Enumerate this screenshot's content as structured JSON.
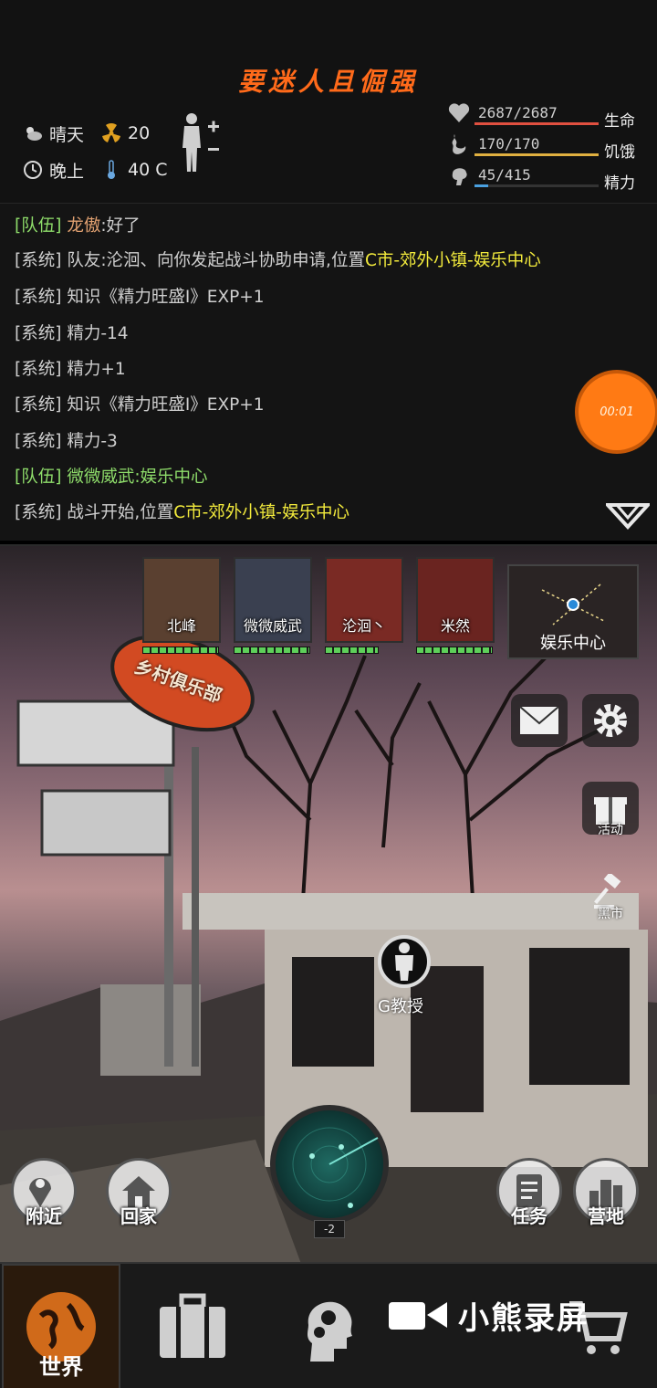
{
  "header": {
    "title": "要迷人且倔强",
    "weather": "晴天",
    "radiation": "20",
    "time_of_day": "晚上",
    "temperature": "40 C"
  },
  "stats": [
    {
      "value": "2687/2687",
      "label": "生命",
      "fraction": 1.0,
      "color": "#e05040",
      "icon": "heart-icon"
    },
    {
      "value": "170/170",
      "label": "饥饿",
      "fraction": 1.0,
      "color": "#e0b040",
      "icon": "stomach-icon"
    },
    {
      "value": "45/415",
      "label": "精力",
      "fraction": 0.108,
      "color": "#4aa0e0",
      "icon": "brain-icon"
    }
  ],
  "chat": {
    "l1": {
      "tag": "[队伍]",
      "name": "龙傲",
      "text": ":好了"
    },
    "l2": {
      "tag": "[系统]",
      "text": "队友:沦洄、向你发起战斗协助申请,位置",
      "loc": "C市-郊外小镇-娱乐中心"
    },
    "l3": {
      "tag": "[系统]",
      "text": "知识《精力旺盛Ⅰ》EXP+1"
    },
    "l4": {
      "tag": "[系统]",
      "text": "精力-14"
    },
    "l5": {
      "tag": "[系统]",
      "text": "精力+1"
    },
    "l6": {
      "tag": "[系统]",
      "text": "知识《精力旺盛Ⅰ》EXP+1"
    },
    "l7": {
      "tag": "[系统]",
      "text": "精力-3"
    },
    "l8": {
      "tag": "[队伍]",
      "text": "微微威武:娱乐中心"
    },
    "l9": {
      "tag": "[系统]",
      "text": "战斗开始,位置",
      "loc": "C市-郊外小镇-娱乐中心"
    }
  },
  "recording_timer": "00:01",
  "party": [
    {
      "name": "北峰",
      "hp": 1.0
    },
    {
      "name": "微微威武",
      "hp": 1.0
    },
    {
      "name": "沦洄丶",
      "hp": 0.7
    },
    {
      "name": "米然",
      "hp": 1.0
    }
  ],
  "minimap_label": "娱乐中心",
  "sign_text": "乡村俱乐部",
  "side": {
    "activity": "活动",
    "blackmarket": "黑市"
  },
  "npc_label": "G教授",
  "actions": {
    "nearby": "附近",
    "home": "回家",
    "quest": "任务",
    "camp": "营地"
  },
  "radar_level": "-2",
  "nav": {
    "world": "世界"
  },
  "watermark": "小熊录屏"
}
